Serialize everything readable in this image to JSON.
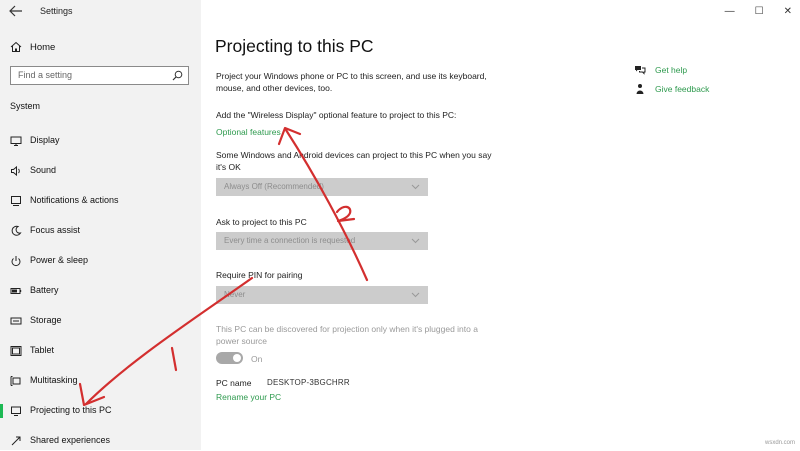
{
  "app": {
    "title": "Settings"
  },
  "sidebar": {
    "home_label": "Home",
    "search_placeholder": "Find a setting",
    "section": "System",
    "items": [
      {
        "label": "Display",
        "icon": "monitor-icon"
      },
      {
        "label": "Sound",
        "icon": "speaker-icon"
      },
      {
        "label": "Notifications & actions",
        "icon": "notifications-icon"
      },
      {
        "label": "Focus assist",
        "icon": "moon-icon"
      },
      {
        "label": "Power & sleep",
        "icon": "power-icon"
      },
      {
        "label": "Battery",
        "icon": "battery-icon"
      },
      {
        "label": "Storage",
        "icon": "storage-icon"
      },
      {
        "label": "Tablet",
        "icon": "tablet-icon"
      },
      {
        "label": "Multitasking",
        "icon": "multitasking-icon"
      },
      {
        "label": "Projecting to this PC",
        "icon": "projecting-icon",
        "active": true
      },
      {
        "label": "Shared experiences",
        "icon": "shared-experiences-icon"
      }
    ]
  },
  "main": {
    "title": "Projecting to this PC",
    "description": "Project your Windows phone or PC to this screen, and use its keyboard, mouse, and other devices, too.",
    "wireless_label": "Add the \"Wireless Display\" optional feature to project to this PC:",
    "optional_link": "Optional features",
    "devices_label": "Some Windows and Android devices can project to this PC when you say it's OK",
    "devices_value": "Always Off (Recommended)",
    "ask_label": "Ask to project to this PC",
    "ask_value": "Every time a connection is requested",
    "pin_label": "Require PIN for pairing",
    "pin_value": "Never",
    "discover_text": "This PC can be discovered for projection only when it's plugged into a power source",
    "toggle_label": "On",
    "pc_name_label": "PC name",
    "pc_name_value": "DESKTOP-3BGCHRR",
    "rename_link": "Rename your PC"
  },
  "help": {
    "get_help": "Get help",
    "feedback": "Give feedback"
  },
  "window_controls": [
    "—",
    "☐",
    "✕"
  ],
  "annotations": {
    "label_1": "1",
    "label_2": "2",
    "arrow_color": "#d32f2f"
  },
  "watermark": "wsxdn.com",
  "colors": {
    "accent": "#2e9a4e",
    "sidebar_bg": "#f2f2f2",
    "dropdown_bg": "#cccccc"
  }
}
